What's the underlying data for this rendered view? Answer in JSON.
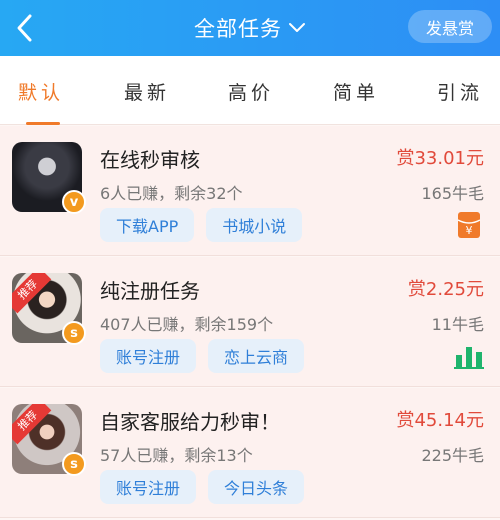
{
  "header": {
    "back_icon": "chevron-left-icon",
    "title": "全部任务",
    "title_dropdown_icon": "chevron-down-icon",
    "post_button": "发悬赏",
    "bg_color": "#2d9cf5"
  },
  "tabs": [
    {
      "label": "默认",
      "active": true
    },
    {
      "label": "最新",
      "active": false
    },
    {
      "label": "高价",
      "active": false
    },
    {
      "label": "简单",
      "active": false
    },
    {
      "label": "引流",
      "active": false
    }
  ],
  "accent_color": "#f07a2a",
  "tasks": [
    {
      "title": "在线秒审核",
      "stats": "6人已赚，剩余32个",
      "reward": "赏33.01元",
      "hair": "165牛毛",
      "tags": [
        "下载APP",
        "书城小说"
      ],
      "avatar": "dark-hooded-avatar",
      "recommended": false,
      "level_badge": "v",
      "category_icon": "red-envelope-icon"
    },
    {
      "title": "纯注册任务",
      "stats": "407人已赚，剩余159个",
      "reward": "赏2.25元",
      "hair": "11牛毛",
      "tags": [
        "账号注册",
        "恋上云商"
      ],
      "avatar": "woman-avatar",
      "recommended": true,
      "recommended_label": "推荐",
      "level_badge": "s",
      "category_icon": "bar-chart-icon"
    },
    {
      "title": "自家客服给力秒审！",
      "stats": "57人已赚，剩余13个",
      "reward": "赏45.14元",
      "hair": "225牛毛",
      "tags": [
        "账号注册",
        "今日头条"
      ],
      "avatar": "woman-avatar-2",
      "recommended": true,
      "recommended_label": "推荐",
      "level_badge": "s",
      "category_icon": "none"
    }
  ]
}
